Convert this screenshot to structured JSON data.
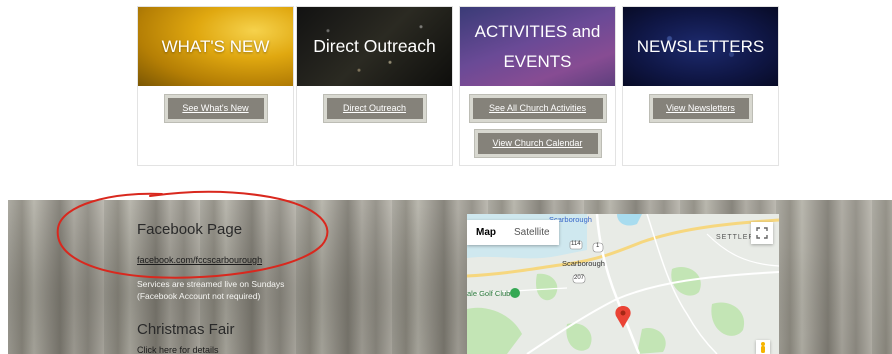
{
  "tiles": [
    {
      "banner": "WHAT'S NEW",
      "buttons": [
        "See What's New"
      ]
    },
    {
      "banner": "Direct Outreach",
      "buttons": [
        "Direct Outreach"
      ]
    },
    {
      "banner_line1": "ACTIVITIES and",
      "banner_line2": "EVENTS",
      "buttons": [
        "See All Church Activities",
        "View Church Calendar"
      ]
    },
    {
      "banner": "NEWSLETTERS",
      "buttons": [
        "View Newsletters"
      ]
    }
  ],
  "facebook": {
    "heading": "Facebook Page",
    "link": "facebook.com/fccscarbourough",
    "note_line1": "Services are streamed live on Sundays",
    "note_line2": "(Facebook Account not required)"
  },
  "christmas_fair": {
    "heading": "Christmas Fair",
    "link": "Click here for details"
  },
  "map": {
    "type_options": [
      "Map",
      "Satellite"
    ],
    "selected_type": "Map",
    "labels": {
      "top_town": "Scarborough",
      "town": "Scarborough",
      "settlers": "SETTLERS",
      "golf": "ale Golf Club",
      "route_114": "114",
      "route_1": "1",
      "route_207": "207",
      "top_right": "Scarborough"
    },
    "icons": [
      "fullscreen-icon",
      "map-pin-icon",
      "pegman-icon",
      "golf-marker-icon"
    ],
    "pin_color": "#ea4335",
    "water_color": "#a8dcef",
    "road_color": "#f6d77f",
    "park_color": "#c3e5b5"
  },
  "colors": {
    "button_bg": "#85827a",
    "annotation_red": "#d9281e"
  }
}
